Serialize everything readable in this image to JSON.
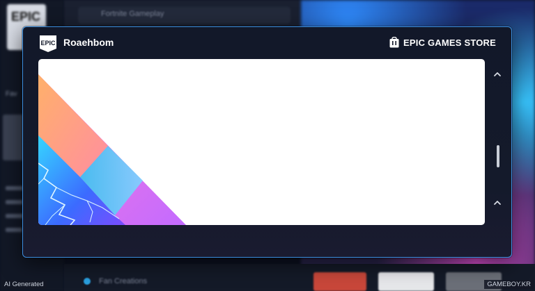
{
  "background": {
    "logo_text": "EPIC",
    "side_label": "Fav",
    "dropdown_text": "Fortnite Gameplay",
    "bottom_text": "Fan Creations"
  },
  "modal": {
    "username": "Roaehbom",
    "store_label": "EPIC GAMES STORE",
    "badge_icon": "epic-games-badge-icon",
    "store_icon": "epic-store-bag-icon",
    "scroll_up_icon": "chevron-up-icon",
    "scroll_down_icon": "chevron-up-icon"
  },
  "footer": {
    "left_tag": "AI Generated",
    "right_tag": "GAMEBOY.KR"
  },
  "colors": {
    "accent_border": "#3c8fe0",
    "modal_bg": "#121829",
    "panel_bg": "#ffffff"
  }
}
